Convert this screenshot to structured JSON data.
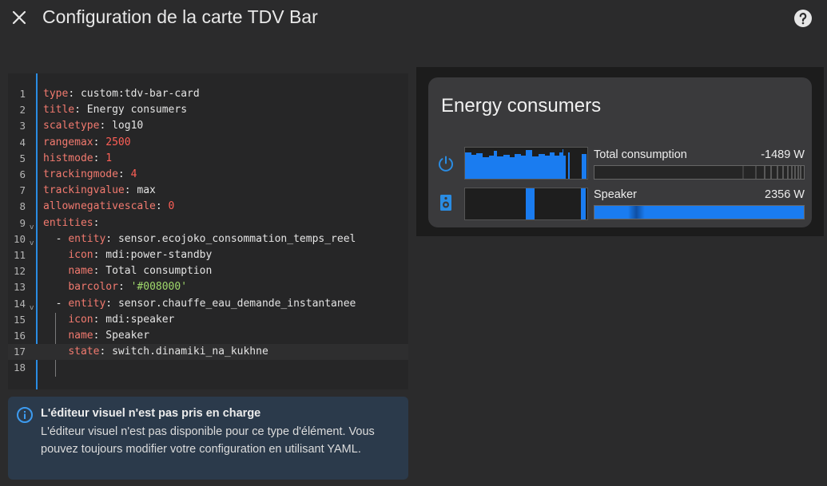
{
  "header": {
    "title": "Configuration de la carte TDV Bar",
    "close_icon": "close-icon",
    "help_icon": "help-circle-icon"
  },
  "editor": {
    "lines": [
      {
        "num": "1",
        "tokens": [
          [
            "k",
            "type"
          ],
          [
            "p",
            ": "
          ],
          [
            "v",
            "custom:tdv-bar-card"
          ]
        ]
      },
      {
        "num": "2",
        "tokens": [
          [
            "k",
            "title"
          ],
          [
            "p",
            ": "
          ],
          [
            "v",
            "Energy consumers"
          ]
        ]
      },
      {
        "num": "3",
        "tokens": [
          [
            "k",
            "scaletype"
          ],
          [
            "p",
            ": "
          ],
          [
            "v",
            "log10"
          ]
        ]
      },
      {
        "num": "4",
        "tokens": [
          [
            "k",
            "rangemax"
          ],
          [
            "p",
            ": "
          ],
          [
            "n",
            "2500"
          ]
        ]
      },
      {
        "num": "5",
        "tokens": [
          [
            "k",
            "histmode"
          ],
          [
            "p",
            ": "
          ],
          [
            "n",
            "1"
          ]
        ]
      },
      {
        "num": "6",
        "tokens": [
          [
            "k",
            "trackingmode"
          ],
          [
            "p",
            ": "
          ],
          [
            "n",
            "4"
          ]
        ]
      },
      {
        "num": "7",
        "tokens": [
          [
            "k",
            "trackingvalue"
          ],
          [
            "p",
            ": "
          ],
          [
            "v",
            "max"
          ]
        ]
      },
      {
        "num": "8",
        "tokens": [
          [
            "k",
            "allownegativescale"
          ],
          [
            "p",
            ": "
          ],
          [
            "n",
            "0"
          ]
        ]
      },
      {
        "num": "9",
        "fold": "v",
        "tokens": [
          [
            "k",
            "entities"
          ],
          [
            "p",
            ":"
          ]
        ]
      },
      {
        "num": "10",
        "fold": "v",
        "tokens": [
          [
            "p",
            "  - "
          ],
          [
            "k",
            "entity"
          ],
          [
            "p",
            ": "
          ],
          [
            "v",
            "sensor.ecojoko_consommation_temps_reel"
          ]
        ]
      },
      {
        "num": "11",
        "tokens": [
          [
            "p",
            "    "
          ],
          [
            "k",
            "icon"
          ],
          [
            "p",
            ": "
          ],
          [
            "v",
            "mdi:power-standby"
          ]
        ]
      },
      {
        "num": "12",
        "tokens": [
          [
            "p",
            "    "
          ],
          [
            "k",
            "name"
          ],
          [
            "p",
            ": "
          ],
          [
            "v",
            "Total consumption"
          ]
        ]
      },
      {
        "num": "13",
        "tokens": [
          [
            "p",
            "    "
          ],
          [
            "k",
            "barcolor"
          ],
          [
            "p",
            ": "
          ],
          [
            "s",
            "'#008000'"
          ]
        ]
      },
      {
        "num": "14",
        "fold": "v",
        "tokens": [
          [
            "p",
            "  - "
          ],
          [
            "k",
            "entity"
          ],
          [
            "p",
            ": "
          ],
          [
            "v",
            "sensor.chauffe_eau_demande_instantanee"
          ]
        ]
      },
      {
        "num": "15",
        "tokens": [
          [
            "p",
            "    "
          ],
          [
            "k",
            "icon"
          ],
          [
            "p",
            ": "
          ],
          [
            "v",
            "mdi:speaker"
          ]
        ]
      },
      {
        "num": "16",
        "tokens": [
          [
            "p",
            "    "
          ],
          [
            "k",
            "name"
          ],
          [
            "p",
            ": "
          ],
          [
            "v",
            "Speaker"
          ]
        ]
      },
      {
        "num": "17",
        "active": true,
        "tokens": [
          [
            "p",
            "    "
          ],
          [
            "k",
            "state"
          ],
          [
            "p",
            ": "
          ],
          [
            "v",
            "switch.dinamiki_na_kukhne"
          ]
        ]
      },
      {
        "num": "18",
        "tokens": []
      }
    ]
  },
  "info": {
    "icon": "info-icon",
    "title": "L'éditeur visuel n'est pas pris en charge",
    "body": "L'éditeur visuel n'est pas disponible pour ce type d'élément. Vous pouvez toujours modifier votre configuration en utilisant YAML."
  },
  "card": {
    "title": "Energy consumers",
    "entities": [
      {
        "icon": "power-standby-icon",
        "name": "Total consumption",
        "value": "-1489 W",
        "bar_fill": 0.0
      },
      {
        "icon": "speaker-icon",
        "name": "Speaker",
        "value": "2356 W",
        "bar_fill": 1.0
      }
    ]
  },
  "colors": {
    "accent": "#2a8ce3",
    "bar_blue": "#1a7cf0",
    "info_bg": "#2b3a4b"
  }
}
